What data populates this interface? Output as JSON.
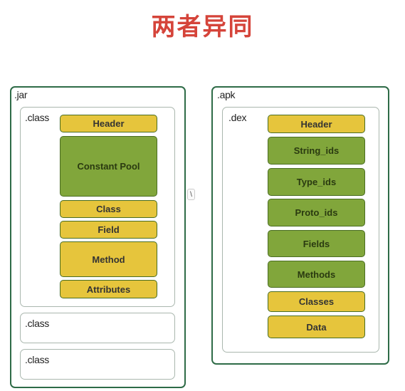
{
  "title": "两者异同",
  "jar": {
    "label": ".jar",
    "class_label": ".class",
    "sections": [
      "Header",
      "Constant Pool",
      "Class",
      "Field",
      "Method",
      "Attributes"
    ],
    "extra_classes": [
      ".class",
      ".class"
    ]
  },
  "apk": {
    "label": ".apk",
    "dex_label": ".dex",
    "sections": [
      "Header",
      "String_ids",
      "Type_ids",
      "Proto_ids",
      "Fields",
      "Methods",
      "Classes",
      "Data"
    ]
  },
  "separator": "\\",
  "colors": {
    "yellow": "#e6c53c",
    "green": "#81a63b",
    "border": "#2e6b47",
    "title": "#d5443a"
  }
}
